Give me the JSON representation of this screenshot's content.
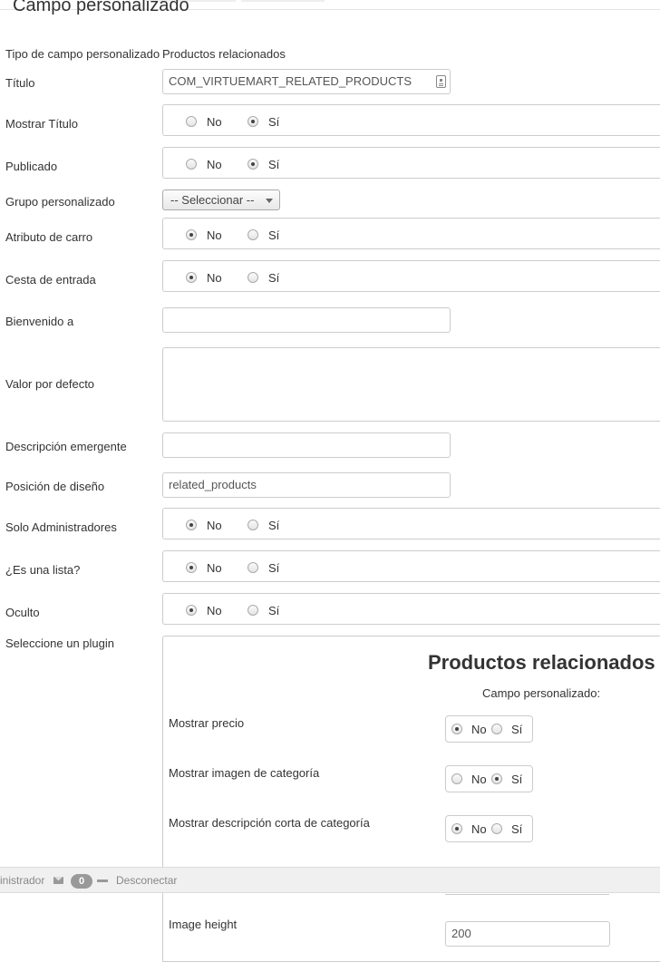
{
  "fieldset": {
    "title": "Campo personalizado"
  },
  "fields": {
    "tipo": {
      "label": "Tipo de campo personalizado",
      "value": "Productos relacionados"
    },
    "titulo": {
      "label": "Título",
      "value": "COM_VIRTUEMART_RELATED_PRODUCTS"
    },
    "mostrar_titulo": {
      "label": "Mostrar Título",
      "no": "No",
      "si": "Sí",
      "selected": "si"
    },
    "publicado": {
      "label": "Publicado",
      "no": "No",
      "si": "Sí",
      "selected": "si"
    },
    "grupo": {
      "label": "Grupo personalizado",
      "value": "-- Seleccionar --"
    },
    "atributo_carro": {
      "label": "Atributo de carro",
      "no": "No",
      "si": "Sí",
      "selected": "no"
    },
    "cesta_entrada": {
      "label": "Cesta de entrada",
      "no": "No",
      "si": "Sí",
      "selected": "no"
    },
    "bienvenido": {
      "label": "Bienvenido a",
      "value": ""
    },
    "valor_defecto": {
      "label": "Valor por defecto",
      "value": ""
    },
    "descripcion": {
      "label": "Descripción emergente",
      "value": ""
    },
    "posicion": {
      "label": "Posición de diseño",
      "value": "related_products"
    },
    "solo_admin": {
      "label": "Solo Administradores",
      "no": "No",
      "si": "Sí",
      "selected": "no"
    },
    "es_lista": {
      "label": "¿Es una lista?",
      "no": "No",
      "si": "Sí",
      "selected": "no"
    },
    "oculto": {
      "label": "Oculto",
      "no": "No",
      "si": "Sí",
      "selected": "no"
    },
    "plugin": {
      "label": "Seleccione un plugin"
    }
  },
  "plugin": {
    "title": "Productos relacionados",
    "subtitle": "Campo personalizado:",
    "options": [
      {
        "label": "Mostrar precio",
        "no": "No",
        "si": "Sí",
        "selected": "no"
      },
      {
        "label": "Mostrar imagen de categoría",
        "no": "No",
        "si": "Sí",
        "selected": "si"
      },
      {
        "label": "Mostrar descripción corta de categoría",
        "no": "No",
        "si": "Sí",
        "selected": "no"
      }
    ],
    "image_height": {
      "label": "Image height",
      "value": "200"
    }
  },
  "statusbar": {
    "user": "inistrador",
    "messages_count": "0",
    "logout": "Desconectar"
  }
}
